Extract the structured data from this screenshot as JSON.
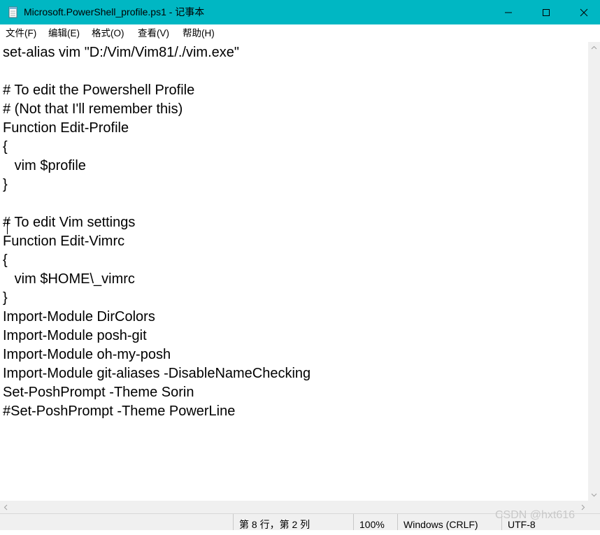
{
  "window": {
    "title": "Microsoft.PowerShell_profile.ps1 - 记事本",
    "accent_color": "#00b7c3"
  },
  "menu": {
    "items": [
      {
        "label": "文件(F)"
      },
      {
        "label": "编辑(E)"
      },
      {
        "label": "格式(O)"
      },
      {
        "label": "查看(V)"
      },
      {
        "label": "帮助(H)"
      }
    ]
  },
  "editor": {
    "lines": [
      "set-alias vim \"D:/Vim/Vim81/./vim.exe\"",
      "",
      "# To edit the Powershell Profile",
      "# (Not that I'll remember this)",
      "Function Edit-Profile",
      "{",
      "   vim $profile",
      "}",
      "",
      "# To edit Vim settings",
      "Function Edit-Vimrc",
      "{",
      "   vim $HOME\\_vimrc",
      "}",
      "Import-Module DirColors",
      "Import-Module posh-git",
      "Import-Module oh-my-posh",
      "Import-Module git-aliases -DisableNameChecking",
      "Set-PoshPrompt -Theme Sorin",
      "#Set-PoshPrompt -Theme PowerLine"
    ]
  },
  "status": {
    "position": "第 8 行，第 2 列",
    "zoom": "100%",
    "line_ending": "Windows (CRLF)",
    "encoding": "UTF-8"
  },
  "watermark": "CSDN @hxt616",
  "icons": {
    "app": "notepad-icon",
    "minimize": "minimize-icon",
    "maximize": "maximize-icon",
    "close": "close-icon",
    "scroll_up": "chevron-up-icon",
    "scroll_down": "chevron-down-icon",
    "scroll_left": "chevron-left-icon",
    "scroll_right": "chevron-right-icon"
  }
}
